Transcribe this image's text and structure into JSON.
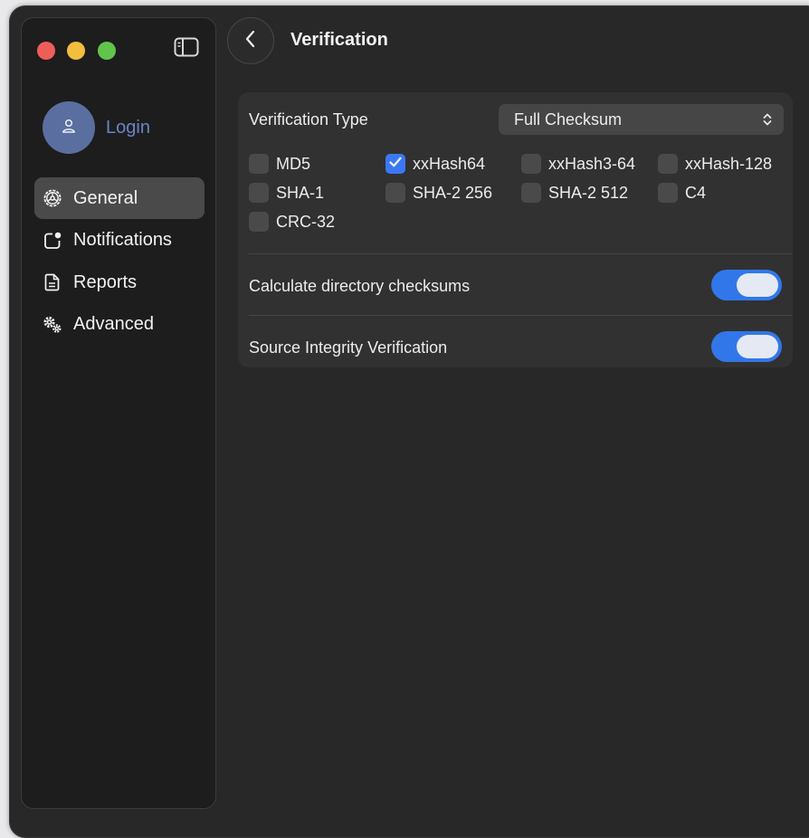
{
  "window": {
    "traffic_lights": [
      "close",
      "minimize",
      "zoom"
    ]
  },
  "sidebar": {
    "toggle_icon": "sidebar-toggle-icon",
    "profile": {
      "label": "Login",
      "icon": "person-icon"
    },
    "items": [
      {
        "label": "General",
        "icon": "gear-icon",
        "active": true
      },
      {
        "label": "Notifications",
        "icon": "notification-badge-icon",
        "active": false
      },
      {
        "label": "Reports",
        "icon": "document-icon",
        "active": false
      },
      {
        "label": "Advanced",
        "icon": "gears-icon",
        "active": false
      }
    ]
  },
  "header": {
    "title": "Verification",
    "back_icon": "chevron-left-icon"
  },
  "verification": {
    "type_label": "Verification Type",
    "type_value": "Full Checksum",
    "algorithms": [
      {
        "label": "MD5",
        "checked": false
      },
      {
        "label": "xxHash64",
        "checked": true
      },
      {
        "label": "xxHash3-64",
        "checked": false
      },
      {
        "label": "xxHash-128",
        "checked": false
      },
      {
        "label": "SHA-1",
        "checked": false
      },
      {
        "label": "SHA-2 256",
        "checked": false
      },
      {
        "label": "SHA-2 512",
        "checked": false
      },
      {
        "label": "C4",
        "checked": false
      },
      {
        "label": "CRC-32",
        "checked": false
      }
    ],
    "toggles": [
      {
        "label": "Calculate directory checksums",
        "on": true
      },
      {
        "label": "Source Integrity Verification",
        "on": true
      }
    ]
  },
  "colors": {
    "accent": "#3277ea",
    "checkbox_checked": "#3b78f5",
    "login_text": "#6d84c7",
    "avatar_bg": "#5a6fa0"
  }
}
